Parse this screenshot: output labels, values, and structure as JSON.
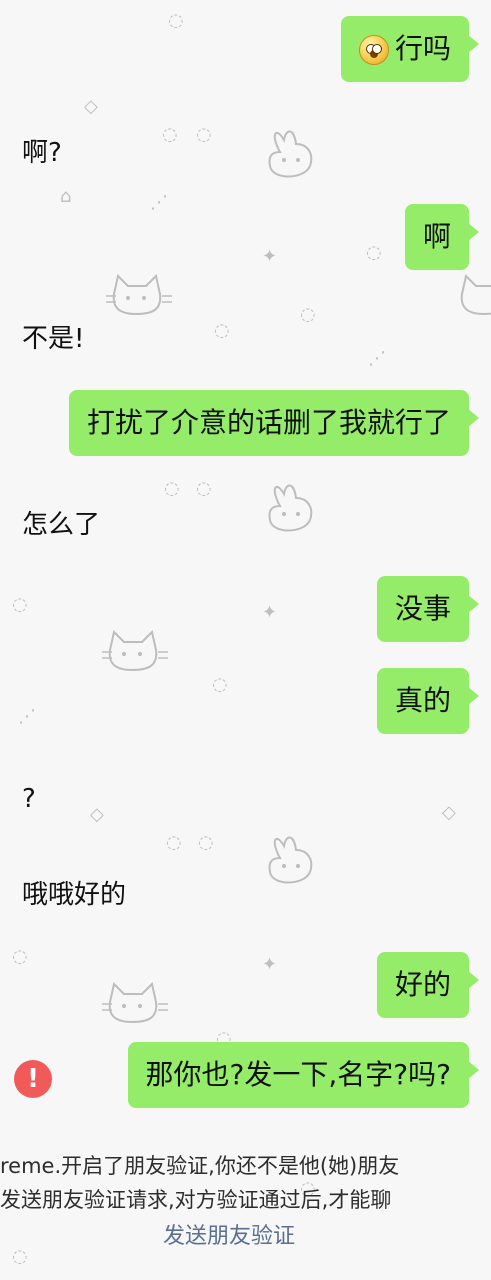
{
  "messages": {
    "sent_1_text": "行吗",
    "received_1": "啊?",
    "sent_2": "啊",
    "received_2": "不是!",
    "sent_3": "打扰了介意的话删了我就行了",
    "received_3": "怎么了",
    "sent_4": "没事",
    "sent_5": "真的",
    "received_4": "?",
    "received_5": "哦哦好的",
    "sent_6": "好的",
    "sent_7": "那你也?发一下,名字?吗?"
  },
  "notice": {
    "line_1": "reme.开启了朋友验证,你还不是他(她)朋友",
    "line_2": "发送朋友验证请求,对方验证通过后,才能聊",
    "link": "发送朋友验证"
  },
  "icons": {
    "error": "!"
  },
  "colors": {
    "sent_bubble": "#95ec69",
    "error": "#f25a5a",
    "link": "#5a6f93"
  }
}
